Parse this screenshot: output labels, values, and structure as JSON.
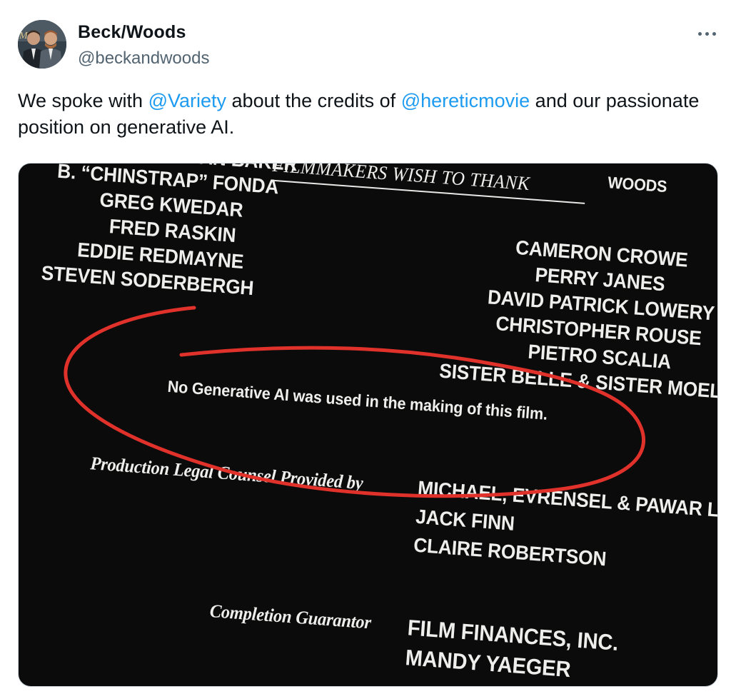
{
  "author": {
    "name": "Beck/Woods",
    "handle": "@beckandwoods"
  },
  "tweet": {
    "text_part1": "We spoke with ",
    "mention1": "@Variety",
    "text_part2": " about the credits of ",
    "mention2": "@hereticmovie",
    "text_part3": " and our passionate position on generative AI."
  },
  "media": {
    "credits": {
      "top_right_fragment": "WOODS",
      "heading": "FILMMAKERS WISH TO THANK",
      "left_names": [
        "JOSH & JONATHAN BAKER",
        "B. “CHINSTRAP” FONDA",
        "GREG KWEDAR",
        "FRED RASKIN",
        "EDDIE REDMAYNE",
        "STEVEN SODERBERGH"
      ],
      "right_names": [
        "CAMERON CROWE",
        "PERRY JANES",
        "DAVID PATRICK LOWERY",
        "CHRISTOPHER ROUSE",
        "PIETRO SCALIA",
        "SISTER BELLE & SISTER MOELLER"
      ],
      "ai_notice": "No Generative AI was used in the making of this film.",
      "legal_role": "Production Legal Counsel Provided by",
      "legal_names": [
        "MICHAEL, EVRENSEL & PAWAR LLP",
        "JACK FINN",
        "CLAIRE ROBERTSON"
      ],
      "guarantor_role": "Completion Guarantor",
      "guarantor_names": [
        "FILM FINANCES, INC.",
        "MANDY YAEGER"
      ]
    },
    "annotation_color": "#e0312b"
  },
  "colors": {
    "mention": "#1d9bf0",
    "handle": "#536471"
  }
}
